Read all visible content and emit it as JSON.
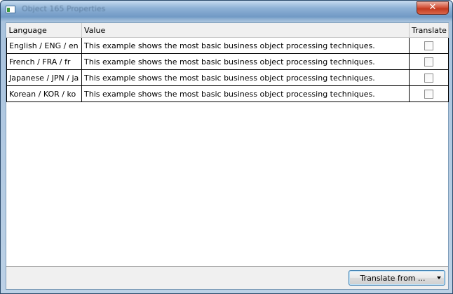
{
  "window": {
    "title": "Object 165 Properties",
    "close_glyph": "✕"
  },
  "grid": {
    "columns": [
      "Language",
      "Value",
      "Translate"
    ],
    "rows": [
      {
        "language": "English / ENG / en",
        "value": "This example shows the most basic business object processing techniques.",
        "translate": false
      },
      {
        "language": "French / FRA / fr",
        "value": "This example shows the most basic business object processing techniques.",
        "translate": false
      },
      {
        "language": "Japanese / JPN / ja",
        "value": "This example shows the most basic business object processing techniques.",
        "translate": false
      },
      {
        "language": "Korean / KOR / ko",
        "value": "This example shows the most basic business object processing techniques.",
        "translate": false
      }
    ]
  },
  "footer": {
    "translate_button_label": "Translate from ..."
  }
}
